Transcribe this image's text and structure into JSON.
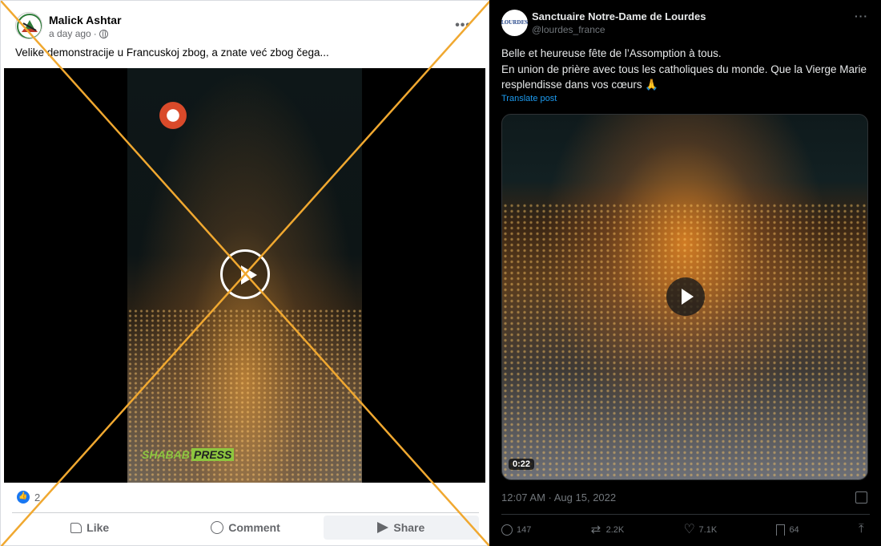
{
  "facebook_post": {
    "author": "Malick Ashtar",
    "timestamp": "a day ago",
    "privacy_icon": "globe-icon",
    "more_icon": "•••",
    "text": "Velike demonstracije u Francuskoj zbog, a znate već zbog čega...",
    "watermark": "SHABAB PRESS",
    "watermark_part1": "SHABAB",
    "watermark_part2": "PRESS",
    "reaction_count": "2",
    "actions": {
      "like": "Like",
      "comment": "Comment",
      "share": "Share"
    }
  },
  "overlay": {
    "cross_color": "#f0a830"
  },
  "x_post": {
    "avatar_text": "LOURDES",
    "account_name": "Sanctuaire Notre-Dame de Lourdes",
    "handle": "@lourdes_france",
    "more_icon": "···",
    "text_line1": "Belle et heureuse fête de l’Assomption à tous.",
    "text_line2": "En union de prière avec tous les catholiques du monde. Que la Vierge Marie resplendisse dans vos cœurs 🙏",
    "translate_label": "Translate post",
    "video_duration": "0:22",
    "posted_time": "12:07 AM · Aug 15, 2022",
    "stats": {
      "replies": "147",
      "reposts": "2.2K",
      "likes": "7.1K",
      "bookmarks": "64"
    },
    "colors": {
      "background": "#000000",
      "text": "#e7e9ea",
      "muted": "#71767b",
      "link": "#1d9bf0"
    }
  }
}
